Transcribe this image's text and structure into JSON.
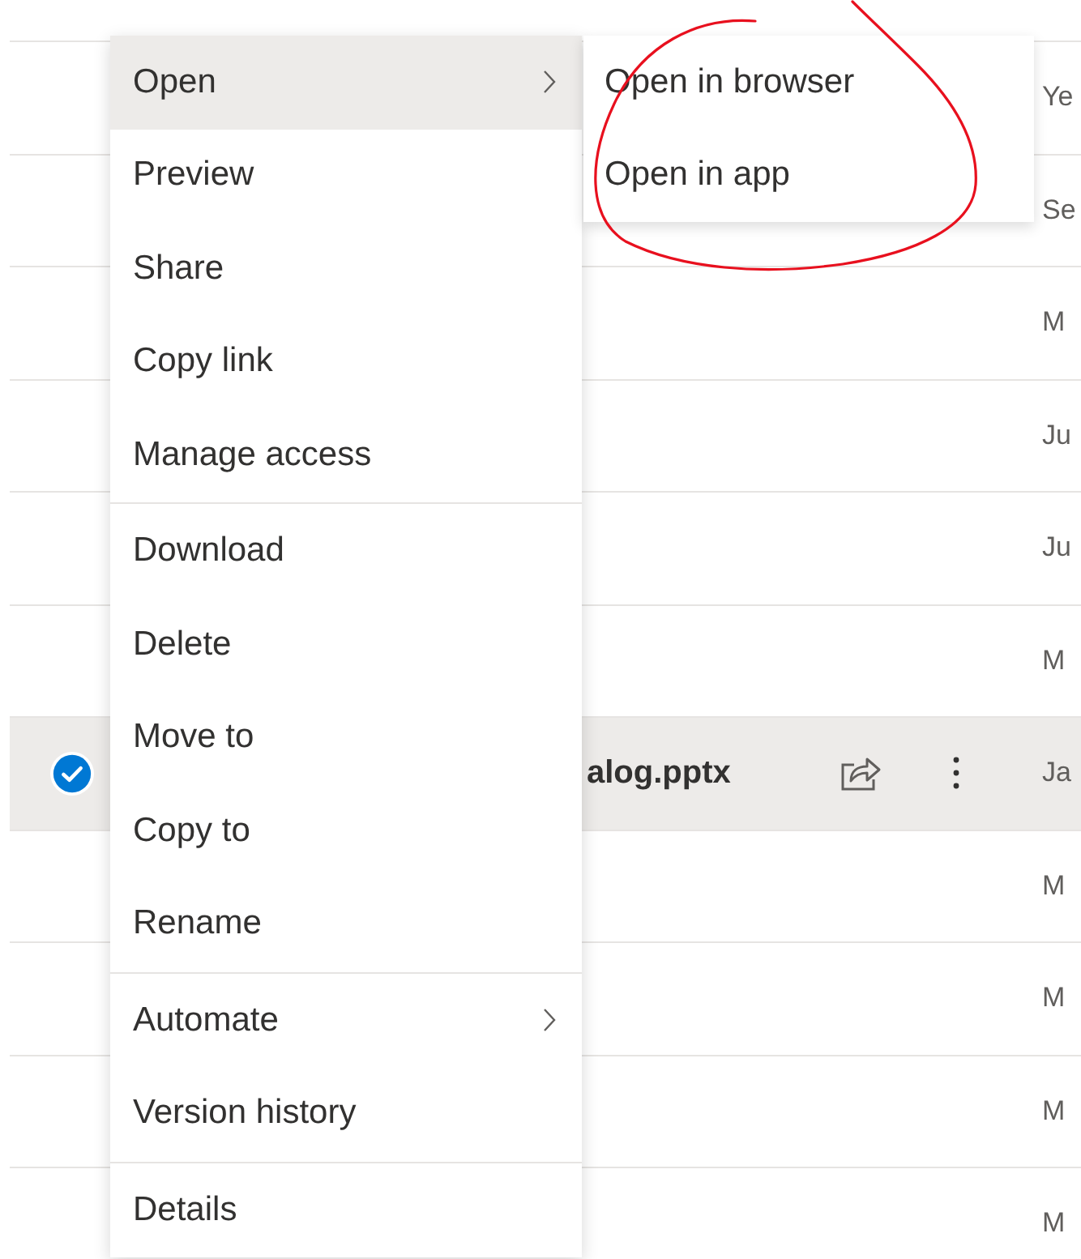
{
  "file_list": {
    "rows": [
      {
        "selected": false,
        "date": "Ye"
      },
      {
        "selected": false,
        "date": "Se"
      },
      {
        "selected": false,
        "date": "M"
      },
      {
        "selected": false,
        "date": "Ju"
      },
      {
        "selected": false,
        "date": "Ju"
      },
      {
        "selected": false,
        "date": "M"
      },
      {
        "selected": true,
        "name": "alog.pptx",
        "date": "Ja"
      },
      {
        "selected": false,
        "date": "M"
      },
      {
        "selected": false,
        "date": "M"
      },
      {
        "selected": false,
        "date": "M"
      },
      {
        "selected": false,
        "date": "M"
      }
    ]
  },
  "menu": {
    "groups": [
      {
        "items": [
          {
            "label": "Open",
            "chevron": true,
            "highlighted": true
          },
          {
            "label": "Preview",
            "chevron": false,
            "highlighted": false
          },
          {
            "label": "Share",
            "chevron": false,
            "highlighted": false
          },
          {
            "label": "Copy link",
            "chevron": false,
            "highlighted": false
          },
          {
            "label": "Manage access",
            "chevron": false,
            "highlighted": false
          }
        ]
      },
      {
        "items": [
          {
            "label": "Download",
            "chevron": false,
            "highlighted": false
          },
          {
            "label": "Delete",
            "chevron": false,
            "highlighted": false
          },
          {
            "label": "Move to",
            "chevron": false,
            "highlighted": false
          },
          {
            "label": "Copy to",
            "chevron": false,
            "highlighted": false
          },
          {
            "label": "Rename",
            "chevron": false,
            "highlighted": false
          }
        ]
      },
      {
        "items": [
          {
            "label": "Automate",
            "chevron": true,
            "highlighted": false
          },
          {
            "label": "Version history",
            "chevron": false,
            "highlighted": false
          }
        ]
      },
      {
        "items": [
          {
            "label": "Details",
            "chevron": false,
            "highlighted": false
          }
        ]
      }
    ]
  },
  "submenu": {
    "items": [
      {
        "label": "Open in browser"
      },
      {
        "label": "Open in app"
      }
    ]
  }
}
